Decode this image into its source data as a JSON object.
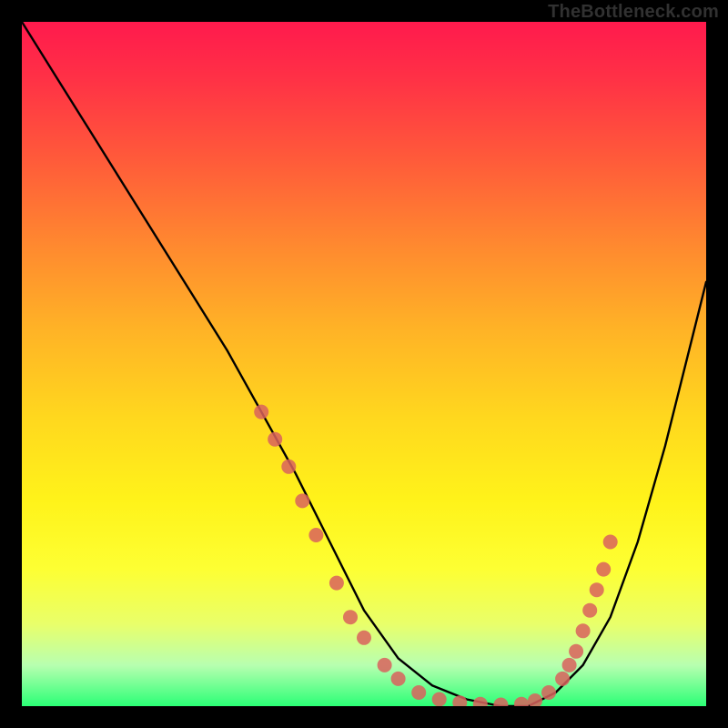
{
  "watermark": "TheBottleneck.com",
  "chart_data": {
    "type": "line",
    "title": "",
    "xlabel": "",
    "ylabel": "",
    "xlim": [
      0,
      100
    ],
    "ylim": [
      0,
      100
    ],
    "grid": false,
    "legend": false,
    "series": [
      {
        "name": "bottleneck-curve",
        "x": [
          0,
          5,
          10,
          15,
          20,
          25,
          30,
          35,
          40,
          45,
          50,
          55,
          60,
          65,
          70,
          74,
          78,
          82,
          86,
          90,
          94,
          98,
          100
        ],
        "y": [
          100,
          92,
          84,
          76,
          68,
          60,
          52,
          43,
          34,
          24,
          14,
          7,
          3,
          1,
          0,
          0,
          2,
          6,
          13,
          24,
          38,
          54,
          62
        ]
      }
    ],
    "markers": [
      {
        "x": 35,
        "y": 43
      },
      {
        "x": 37,
        "y": 39
      },
      {
        "x": 39,
        "y": 35
      },
      {
        "x": 41,
        "y": 30
      },
      {
        "x": 43,
        "y": 25
      },
      {
        "x": 46,
        "y": 18
      },
      {
        "x": 48,
        "y": 13
      },
      {
        "x": 50,
        "y": 10
      },
      {
        "x": 53,
        "y": 6
      },
      {
        "x": 55,
        "y": 4
      },
      {
        "x": 58,
        "y": 2
      },
      {
        "x": 61,
        "y": 1
      },
      {
        "x": 64,
        "y": 0.5
      },
      {
        "x": 67,
        "y": 0.3
      },
      {
        "x": 70,
        "y": 0.2
      },
      {
        "x": 73,
        "y": 0.3
      },
      {
        "x": 75,
        "y": 0.8
      },
      {
        "x": 77,
        "y": 2
      },
      {
        "x": 79,
        "y": 4
      },
      {
        "x": 80,
        "y": 6
      },
      {
        "x": 81,
        "y": 8
      },
      {
        "x": 82,
        "y": 11
      },
      {
        "x": 83,
        "y": 14
      },
      {
        "x": 84,
        "y": 17
      },
      {
        "x": 85,
        "y": 20
      },
      {
        "x": 86,
        "y": 24
      }
    ],
    "marker_color": "#d9625d",
    "curve_color": "#000000"
  }
}
